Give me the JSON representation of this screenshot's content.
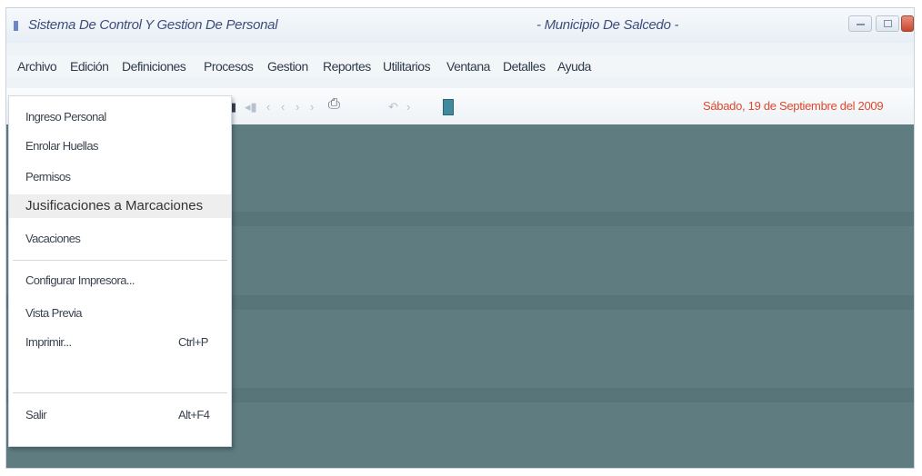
{
  "window": {
    "title": "Sistema De Control Y Gestion De Personal",
    "subtitle": "- Municipio De Salcedo -"
  },
  "menu": {
    "items": [
      "Archivo",
      "Edición",
      "Definiciones",
      "Procesos",
      "Gestion",
      "Reportes",
      "Utilitarios",
      "Ventana",
      "Detalles",
      "Ayuda"
    ]
  },
  "toolbar": {
    "date": "Sábado, 19 de Septiembre del 2009"
  },
  "dropdown": {
    "items": [
      {
        "label": "Ingreso Personal",
        "shortcut": ""
      },
      {
        "label": "Enrolar Huellas",
        "shortcut": ""
      },
      {
        "label": "Permisos",
        "shortcut": ""
      },
      {
        "label": "Jusificaciones a Marcaciones",
        "shortcut": ""
      },
      {
        "label": "Vacaciones",
        "shortcut": ""
      },
      {
        "label": "Configurar Impresora...",
        "shortcut": ""
      },
      {
        "label": "Vista Previa",
        "shortcut": ""
      },
      {
        "label": "Imprimir...",
        "shortcut": "Ctrl+P"
      },
      {
        "label": "",
        "shortcut": ""
      },
      {
        "label": "Salir",
        "shortcut": "Alt+F4"
      }
    ]
  },
  "colors": {
    "client_area": "#5f7c80",
    "date_text": "#e0482d",
    "highlight": "#eeeeee"
  }
}
